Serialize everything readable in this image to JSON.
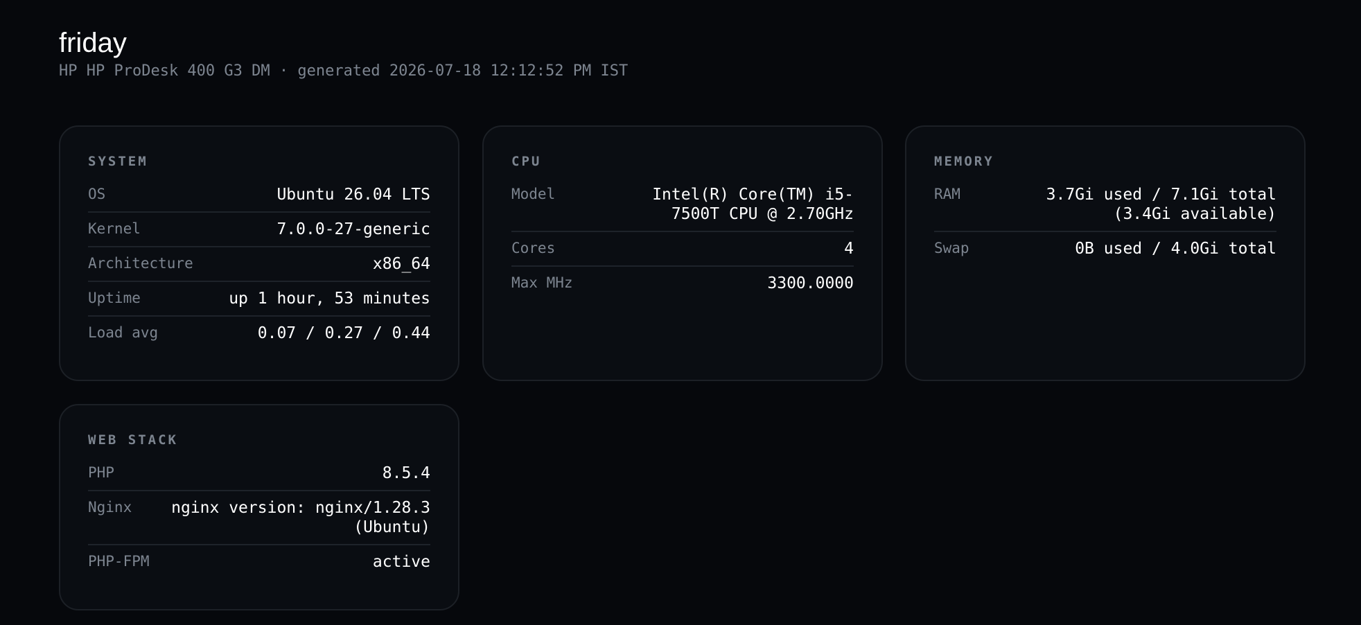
{
  "header": {
    "title": "friday",
    "subtitle": "HP HP ProDesk 400 G3 DM · generated 2026-07-18 12:12:52 PM IST"
  },
  "system": {
    "title": "SYSTEM",
    "rows": [
      {
        "label": "OS",
        "value": "Ubuntu 26.04 LTS"
      },
      {
        "label": "Kernel",
        "value": "7.0.0-27-generic"
      },
      {
        "label": "Architecture",
        "value": "x86_64"
      },
      {
        "label": "Uptime",
        "value": "up 1 hour, 53 minutes"
      },
      {
        "label": "Load avg",
        "value": "0.07 / 0.27 / 0.44"
      }
    ]
  },
  "cpu": {
    "title": "CPU",
    "rows": [
      {
        "label": "Model",
        "value": "Intel(R) Core(TM) i5-7500T CPU @ 2.70GHz"
      },
      {
        "label": "Cores",
        "value": "4"
      },
      {
        "label": "Max MHz",
        "value": "3300.0000"
      }
    ]
  },
  "memory": {
    "title": "MEMORY",
    "rows": [
      {
        "label": "RAM",
        "value": "3.7Gi used / 7.1Gi total (3.4Gi available)"
      },
      {
        "label": "Swap",
        "value": "0B used / 4.0Gi total"
      }
    ]
  },
  "web_stack": {
    "title": "WEB STACK",
    "rows": [
      {
        "label": "PHP",
        "value": "8.5.4"
      },
      {
        "label": "Nginx",
        "value": "nginx version: nginx/1.28.3 (Ubuntu)"
      },
      {
        "label": "PHP-FPM",
        "value": "active"
      }
    ]
  }
}
